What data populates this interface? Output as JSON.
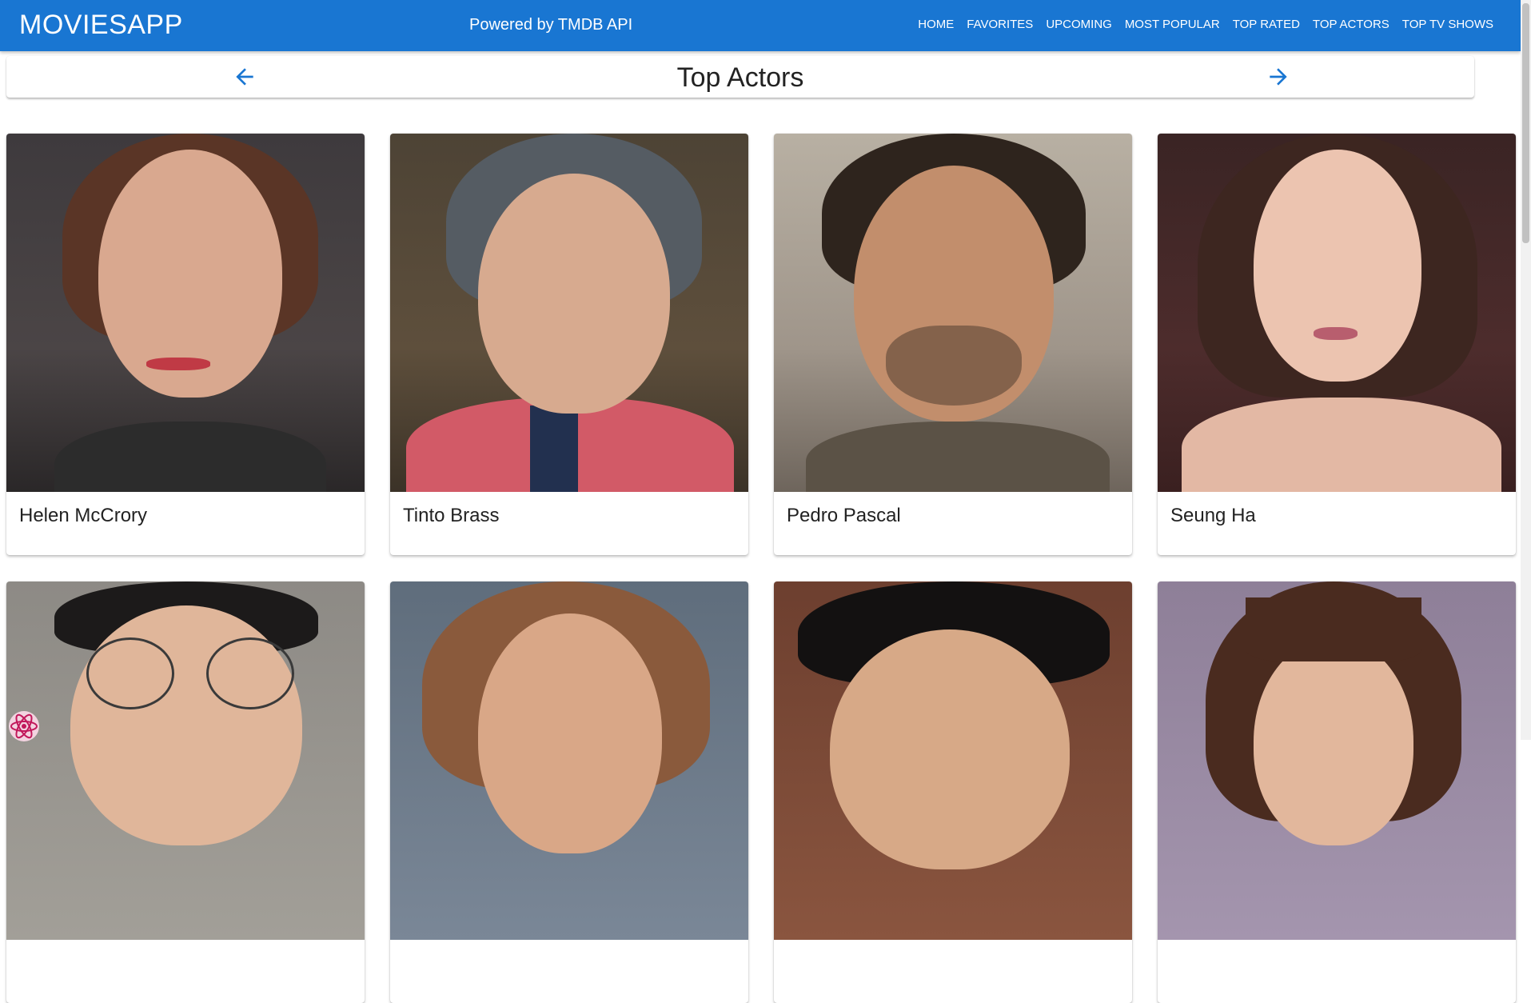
{
  "app": {
    "brand": "MOVIESAPP",
    "powered_by": "Powered by TMDB API",
    "accent_color": "#1976d2"
  },
  "nav": {
    "items": [
      {
        "label": "HOME"
      },
      {
        "label": "FAVORITES"
      },
      {
        "label": "UPCOMING"
      },
      {
        "label": "MOST POPULAR"
      },
      {
        "label": "TOP RATED"
      },
      {
        "label": "TOP ACTORS"
      },
      {
        "label": "TOP TV SHOWS"
      }
    ]
  },
  "page": {
    "title": "Top Actors",
    "back_icon": "arrow-back-icon",
    "forward_icon": "arrow-forward-icon"
  },
  "actors": [
    {
      "name": "Helen McCrory"
    },
    {
      "name": "Tinto Brass"
    },
    {
      "name": "Pedro Pascal"
    },
    {
      "name": "Seung Ha"
    },
    {
      "name": ""
    },
    {
      "name": ""
    },
    {
      "name": ""
    },
    {
      "name": ""
    }
  ]
}
